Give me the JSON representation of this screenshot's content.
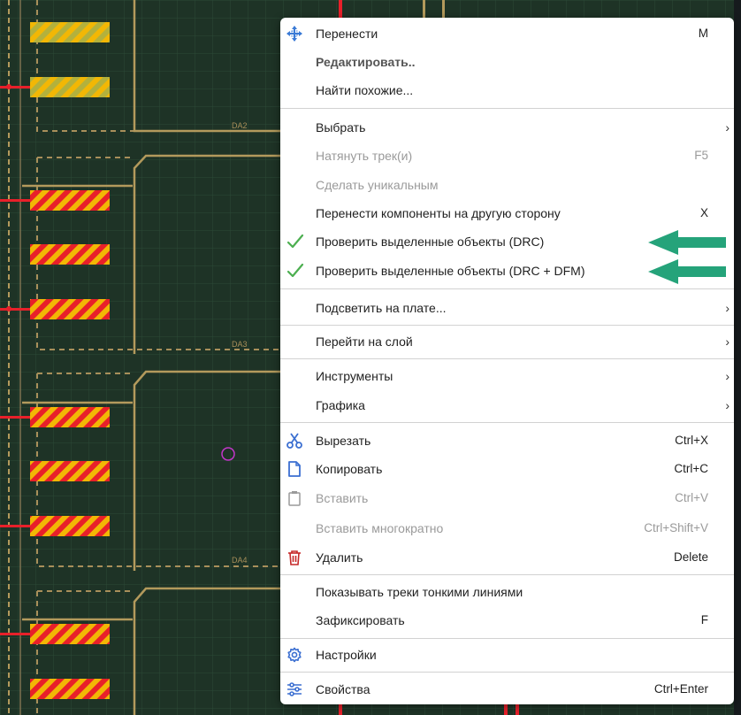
{
  "board": {
    "labels": [
      "DA2",
      "DA3",
      "DA4"
    ]
  },
  "menu": {
    "items": [
      {
        "id": "move",
        "label": "Перенести",
        "shortcut": "M",
        "icon": "move-icon"
      },
      {
        "id": "edit",
        "label": "Редактировать..",
        "bold": true
      },
      {
        "id": "find-similar",
        "label": "Найти похожие..."
      },
      {
        "id": "select",
        "label": "Выбрать",
        "submenu": true
      },
      {
        "id": "pull-track",
        "label": "Натянуть трек(и)",
        "shortcut": "F5",
        "disabled": true
      },
      {
        "id": "make-unique",
        "label": "Сделать уникальным",
        "disabled": true
      },
      {
        "id": "move-other-side",
        "label": "Перенести компоненты на другую сторону",
        "shortcut": "X"
      },
      {
        "id": "check-drc",
        "label": "Проверить выделенные объекты (DRC)",
        "icon": "checkmark-icon"
      },
      {
        "id": "check-drc-dfm",
        "label": "Проверить выделенные объекты (DRC + DFM)",
        "icon": "checkmark-icon"
      },
      {
        "id": "highlight-board",
        "label": "Подсветить на плате...",
        "submenu": true
      },
      {
        "id": "goto-layer",
        "label": "Перейти на слой",
        "submenu": true
      },
      {
        "id": "tools",
        "label": "Инструменты",
        "submenu": true
      },
      {
        "id": "graphics",
        "label": "Графика",
        "submenu": true
      },
      {
        "id": "cut",
        "label": "Вырезать",
        "shortcut": "Ctrl+X",
        "icon": "scissors-icon"
      },
      {
        "id": "copy",
        "label": "Копировать",
        "shortcut": "Ctrl+C",
        "icon": "copy-icon"
      },
      {
        "id": "paste",
        "label": "Вставить",
        "shortcut": "Ctrl+V",
        "icon": "clipboard-icon",
        "disabled": true
      },
      {
        "id": "paste-multiple",
        "label": "Вставить многократно",
        "shortcut": "Ctrl+Shift+V",
        "disabled": true
      },
      {
        "id": "delete",
        "label": "Удалить",
        "shortcut": "Delete",
        "icon": "trash-icon"
      },
      {
        "id": "thin-tracks",
        "label": "Показывать треки тонкими линиями"
      },
      {
        "id": "lock",
        "label": "Зафиксировать",
        "shortcut": "F"
      },
      {
        "id": "settings",
        "label": "Настройки",
        "icon": "gear-icon"
      },
      {
        "id": "properties",
        "label": "Свойства",
        "shortcut": "Ctrl+Enter",
        "icon": "sliders-icon"
      }
    ]
  },
  "colors": {
    "board_bg": "#1e3326",
    "grid": "#2c4a37",
    "outline": "#b39a5c",
    "pad_red": "#e8202a",
    "pad_yellow": "#f2b705",
    "pad_olive": "#b3b13c",
    "accent_green": "#25a37a",
    "check_green": "#4caf50",
    "delete_red": "#c62828"
  }
}
